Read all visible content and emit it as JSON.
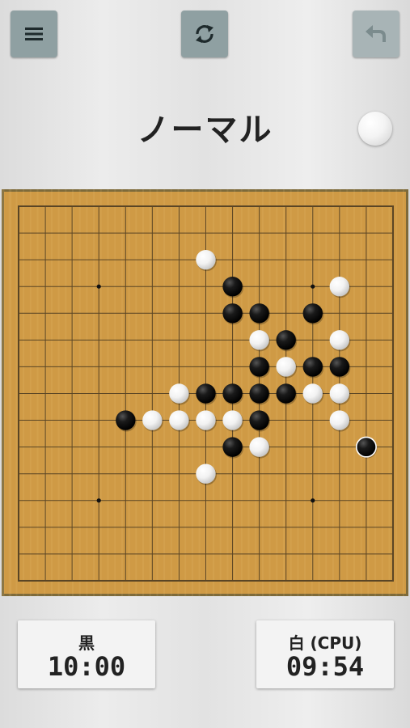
{
  "header": {
    "title": "ノーマル",
    "menu_icon": "hamburger-menu-icon",
    "reset_icon": "refresh-icon",
    "undo_icon": "undo-arrow-icon",
    "turn_stone_color": "white"
  },
  "board": {
    "size": 15,
    "star_points": [
      [
        3,
        3
      ],
      [
        11,
        3
      ],
      [
        3,
        11
      ],
      [
        11,
        11
      ]
    ],
    "stones": [
      {
        "col": 7,
        "row": 2,
        "color": "white"
      },
      {
        "col": 8,
        "row": 3,
        "color": "black"
      },
      {
        "col": 12,
        "row": 3,
        "color": "white"
      },
      {
        "col": 8,
        "row": 4,
        "color": "black"
      },
      {
        "col": 9,
        "row": 4,
        "color": "black"
      },
      {
        "col": 11,
        "row": 4,
        "color": "black"
      },
      {
        "col": 9,
        "row": 5,
        "color": "white"
      },
      {
        "col": 10,
        "row": 5,
        "color": "black"
      },
      {
        "col": 12,
        "row": 5,
        "color": "white"
      },
      {
        "col": 9,
        "row": 6,
        "color": "black"
      },
      {
        "col": 10,
        "row": 6,
        "color": "white"
      },
      {
        "col": 11,
        "row": 6,
        "color": "black"
      },
      {
        "col": 12,
        "row": 6,
        "color": "black"
      },
      {
        "col": 6,
        "row": 7,
        "color": "white"
      },
      {
        "col": 7,
        "row": 7,
        "color": "black"
      },
      {
        "col": 8,
        "row": 7,
        "color": "black"
      },
      {
        "col": 9,
        "row": 7,
        "color": "black"
      },
      {
        "col": 10,
        "row": 7,
        "color": "black"
      },
      {
        "col": 11,
        "row": 7,
        "color": "white"
      },
      {
        "col": 12,
        "row": 7,
        "color": "white"
      },
      {
        "col": 4,
        "row": 8,
        "color": "black"
      },
      {
        "col": 5,
        "row": 8,
        "color": "white"
      },
      {
        "col": 6,
        "row": 8,
        "color": "white"
      },
      {
        "col": 7,
        "row": 8,
        "color": "white"
      },
      {
        "col": 8,
        "row": 8,
        "color": "white"
      },
      {
        "col": 9,
        "row": 8,
        "color": "black"
      },
      {
        "col": 12,
        "row": 8,
        "color": "white"
      },
      {
        "col": 8,
        "row": 9,
        "color": "black"
      },
      {
        "col": 9,
        "row": 9,
        "color": "white"
      },
      {
        "col": 13,
        "row": 9,
        "color": "black",
        "last_move": true
      },
      {
        "col": 7,
        "row": 10,
        "color": "white"
      }
    ]
  },
  "timers": {
    "black": {
      "label": "黒",
      "time": "10:00"
    },
    "white": {
      "label": "白 (CPU)",
      "time": "09:54"
    }
  },
  "colors": {
    "button": "#8fa0a2",
    "board": "#cf9a45",
    "frame": "#7d6a3a",
    "line": "#5a4525"
  }
}
